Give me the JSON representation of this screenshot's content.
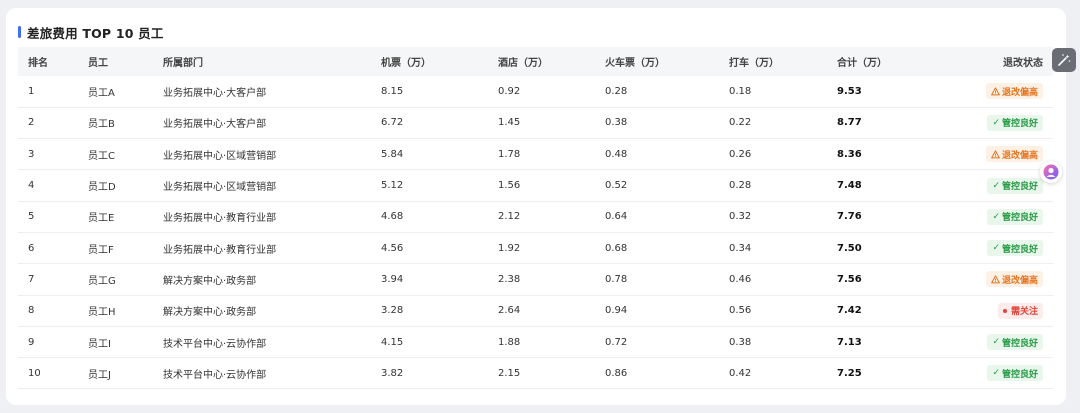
{
  "title": "差旅费用 TOP 10 员工",
  "columns": [
    "排名",
    "员工",
    "所属部门",
    "机票（万）",
    "酒店（万）",
    "火车票（万）",
    "打车（万）",
    "合计（万）",
    "退改状态"
  ],
  "status_types": {
    "warn": {
      "label": "退改偏高",
      "icon": "warning-triangle-icon",
      "color": "#e5731d"
    },
    "good": {
      "label": "管控良好",
      "icon": "check-icon",
      "color": "#2a9b47"
    },
    "attn": {
      "label": "需关注",
      "icon": "red-dot-icon",
      "color": "#e0453c"
    }
  },
  "rows": [
    {
      "rank": "1",
      "name": "员工A",
      "dept": "业务拓展中心·大客户部",
      "flight": "8.15",
      "hotel": "0.92",
      "train": "0.28",
      "taxi": "0.18",
      "total": "9.53",
      "status": "warn"
    },
    {
      "rank": "2",
      "name": "员工B",
      "dept": "业务拓展中心·大客户部",
      "flight": "6.72",
      "hotel": "1.45",
      "train": "0.38",
      "taxi": "0.22",
      "total": "8.77",
      "status": "good"
    },
    {
      "rank": "3",
      "name": "员工C",
      "dept": "业务拓展中心·区域营销部",
      "flight": "5.84",
      "hotel": "1.78",
      "train": "0.48",
      "taxi": "0.26",
      "total": "8.36",
      "status": "warn"
    },
    {
      "rank": "4",
      "name": "员工D",
      "dept": "业务拓展中心·区域营销部",
      "flight": "5.12",
      "hotel": "1.56",
      "train": "0.52",
      "taxi": "0.28",
      "total": "7.48",
      "status": "good"
    },
    {
      "rank": "5",
      "name": "员工E",
      "dept": "业务拓展中心·教育行业部",
      "flight": "4.68",
      "hotel": "2.12",
      "train": "0.64",
      "taxi": "0.32",
      "total": "7.76",
      "status": "good"
    },
    {
      "rank": "6",
      "name": "员工F",
      "dept": "业务拓展中心·教育行业部",
      "flight": "4.56",
      "hotel": "1.92",
      "train": "0.68",
      "taxi": "0.34",
      "total": "7.50",
      "status": "good"
    },
    {
      "rank": "7",
      "name": "员工G",
      "dept": "解决方案中心·政务部",
      "flight": "3.94",
      "hotel": "2.38",
      "train": "0.78",
      "taxi": "0.46",
      "total": "7.56",
      "status": "warn"
    },
    {
      "rank": "8",
      "name": "员工H",
      "dept": "解决方案中心·政务部",
      "flight": "3.28",
      "hotel": "2.64",
      "train": "0.94",
      "taxi": "0.56",
      "total": "7.42",
      "status": "attn"
    },
    {
      "rank": "9",
      "name": "员工I",
      "dept": "技术平台中心·云协作部",
      "flight": "4.15",
      "hotel": "1.88",
      "train": "0.72",
      "taxi": "0.38",
      "total": "7.13",
      "status": "good"
    },
    {
      "rank": "10",
      "name": "员工J",
      "dept": "技术平台中心·云协作部",
      "flight": "3.82",
      "hotel": "2.15",
      "train": "0.86",
      "taxi": "0.42",
      "total": "7.25",
      "status": "good"
    }
  ],
  "colors": {
    "accent": "#3d6ef5",
    "header_bg": "#f5f6f8"
  }
}
